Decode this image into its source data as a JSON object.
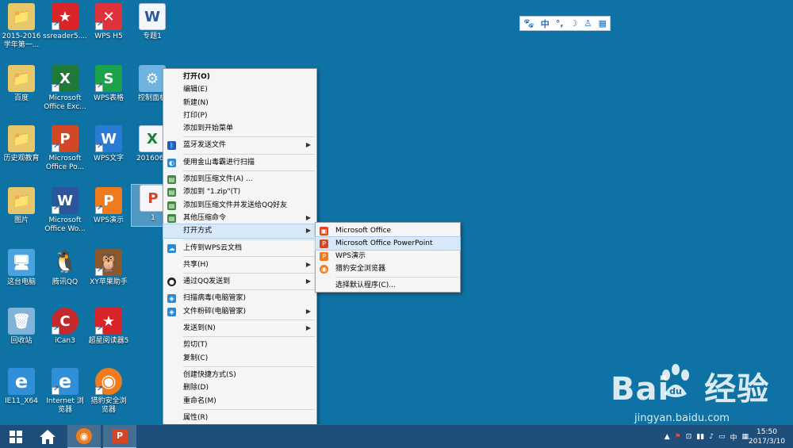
{
  "desktop": {
    "icons": [
      {
        "label": "2015-2016\n学年第一...",
        "glyph": "📁"
      },
      {
        "label": "ssreader5....",
        "glyph": "★"
      },
      {
        "label": "WPS H5",
        "glyph": "✕"
      },
      {
        "label": "专题1",
        "glyph": "W"
      },
      {
        "label": "百度",
        "glyph": "📁"
      },
      {
        "label": "Microsoft\nOffice Exc...",
        "glyph": "X"
      },
      {
        "label": "WPS表格",
        "glyph": "S"
      },
      {
        "label": "控制面板",
        "glyph": "⚙"
      },
      {
        "label": "历史观教育",
        "glyph": "📁"
      },
      {
        "label": "Microsoft\nOffice Po...",
        "glyph": "P"
      },
      {
        "label": "WPS文字",
        "glyph": "W"
      },
      {
        "label": "2016061",
        "glyph": "X"
      },
      {
        "label": "图片",
        "glyph": "📁"
      },
      {
        "label": "Microsoft\nOffice Wo...",
        "glyph": "W"
      },
      {
        "label": "WPS演示",
        "glyph": "P"
      },
      {
        "label": "1",
        "glyph": "P"
      },
      {
        "label": "这台电脑",
        "glyph": "🖥"
      },
      {
        "label": "腾讯QQ",
        "glyph": "🐧"
      },
      {
        "label": "XY苹果助手",
        "glyph": "🦉"
      },
      {
        "label": "回收站",
        "glyph": "🗑"
      },
      {
        "label": "iCan3",
        "glyph": "C"
      },
      {
        "label": "超星阅读器5",
        "glyph": "★"
      },
      {
        "label": "IE11_X64",
        "glyph": "e"
      },
      {
        "label": "Internet 浏\n览器",
        "glyph": "e"
      },
      {
        "label": "猎豹安全浏\n览器",
        "glyph": "◉"
      }
    ]
  },
  "langbar": {
    "items": [
      "🐾",
      "中",
      "°,",
      "☽",
      "♙",
      "▦"
    ]
  },
  "context_menu": {
    "items": [
      {
        "label": "打开(O)"
      },
      {
        "label": "编辑(E)"
      },
      {
        "label": "新建(N)"
      },
      {
        "label": "打印(P)"
      },
      {
        "label": "添加到开始菜单"
      },
      {
        "label": "蓝牙发送文件"
      },
      {
        "label": "使用金山毒霸进行扫描"
      },
      {
        "label": "添加到压缩文件(A) ..."
      },
      {
        "label": "添加到 \"1.zip\"(T)"
      },
      {
        "label": "添加到压缩文件并发送给QQ好友"
      },
      {
        "label": "其他压缩命令"
      },
      {
        "label": "打开方式"
      },
      {
        "label": "上传到WPS云文档"
      },
      {
        "label": "共享(H)"
      },
      {
        "label": "通过QQ发送到"
      },
      {
        "label": "扫描病毒(电脑管家)"
      },
      {
        "label": "文件粉碎(电脑管家)"
      },
      {
        "label": "发送到(N)"
      },
      {
        "label": "剪切(T)"
      },
      {
        "label": "复制(C)"
      },
      {
        "label": "创建快捷方式(S)"
      },
      {
        "label": "删除(D)"
      },
      {
        "label": "重命名(M)"
      },
      {
        "label": "属性(R)"
      }
    ]
  },
  "submenu": {
    "items": [
      {
        "label": "Microsoft Office"
      },
      {
        "label": "Microsoft Office PowerPoint"
      },
      {
        "label": "WPS演示"
      },
      {
        "label": "猎豹安全浏览器"
      },
      {
        "label": "选择默认程序(C)..."
      }
    ]
  },
  "watermark": {
    "logo_left": "Bai",
    "logo_right": "经验",
    "url": "jingyan.baidu.com"
  },
  "taskbar": {
    "tray": [
      "▲",
      "⚑",
      "⊡",
      "▮▮",
      "♪",
      "▭",
      "中",
      "▦"
    ],
    "time": "15:50",
    "date": "2017/3/10"
  },
  "colors": {
    "desktop": "#0f72a4",
    "menu_hover": "#d7e8f8"
  }
}
